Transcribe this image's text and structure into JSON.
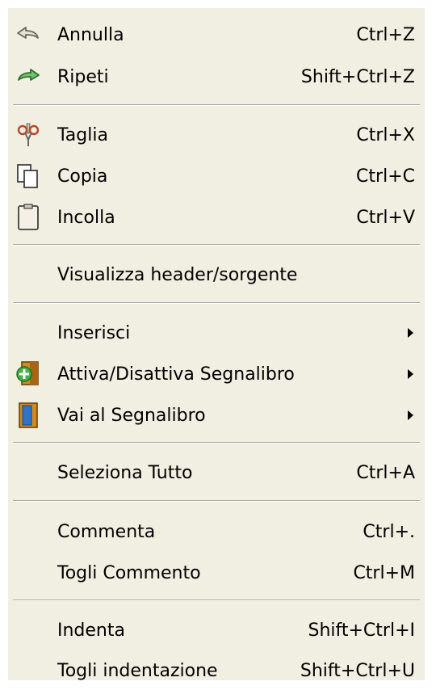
{
  "menu": {
    "undo": {
      "label": "Annulla",
      "shortcut": "Ctrl+Z"
    },
    "redo": {
      "label": "Ripeti",
      "shortcut": "Shift+Ctrl+Z"
    },
    "cut": {
      "label": "Taglia",
      "shortcut": "Ctrl+X"
    },
    "copy": {
      "label": "Copia",
      "shortcut": "Ctrl+C"
    },
    "paste": {
      "label": "Incolla",
      "shortcut": "Ctrl+V"
    },
    "toggle_header": {
      "label": "Visualizza header/sorgente"
    },
    "insert": {
      "label": "Inserisci"
    },
    "toggle_bookmark": {
      "label": "Attiva/Disattiva Segnalibro"
    },
    "goto_bookmark": {
      "label": "Vai al Segnalibro"
    },
    "select_all": {
      "label": "Seleziona Tutto",
      "shortcut": "Ctrl+A"
    },
    "comment": {
      "label": "Commenta",
      "shortcut": "Ctrl+."
    },
    "uncomment": {
      "label": "Togli Commento",
      "shortcut": "Ctrl+M"
    },
    "indent": {
      "label": "Indenta",
      "shortcut": "Shift+Ctrl+I"
    },
    "unindent": {
      "label": "Togli indentazione",
      "shortcut": "Shift+Ctrl+U"
    }
  },
  "icons": {
    "undo": "undo-arrow-icon",
    "redo": "redo-arrow-icon",
    "cut": "scissors-icon",
    "copy": "copy-icon",
    "paste": "paste-clipboard-icon",
    "toggle_bookmark": "bookmark-add-icon",
    "goto_bookmark": "bookmark-icon",
    "submenu": "submenu-arrow-icon"
  },
  "colors": {
    "menu_bg": "#f1efe2",
    "separator": "#a9a79b",
    "redo_green": "#3a8f3a",
    "bookmark_orange": "#d08a22",
    "bookmark_blue": "#2d74c9"
  }
}
